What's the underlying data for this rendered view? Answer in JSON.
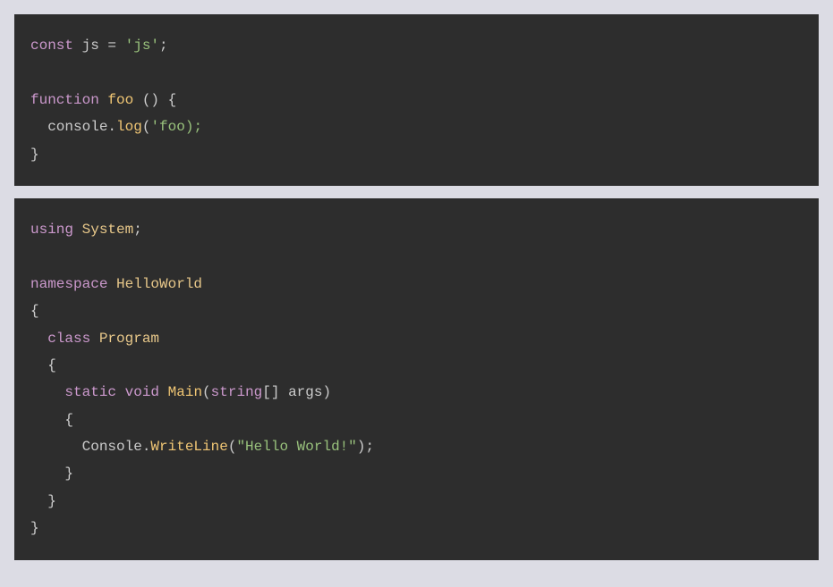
{
  "blocks": [
    {
      "lang": "javascript",
      "tokens": [
        [
          {
            "t": "const ",
            "c": "kw"
          },
          {
            "t": "js ",
            "c": "plain"
          },
          {
            "t": "= ",
            "c": "plain"
          },
          {
            "t": "'js'",
            "c": "str"
          },
          {
            "t": ";",
            "c": "plain"
          }
        ],
        [
          {
            "t": "",
            "c": "plain"
          }
        ],
        [
          {
            "t": "function ",
            "c": "kw"
          },
          {
            "t": "foo ",
            "c": "fn"
          },
          {
            "t": "() {",
            "c": "plain"
          }
        ],
        [
          {
            "t": "  console.",
            "c": "plain"
          },
          {
            "t": "log",
            "c": "fn"
          },
          {
            "t": "(",
            "c": "plain"
          },
          {
            "t": "'foo);",
            "c": "str"
          }
        ],
        [
          {
            "t": "}",
            "c": "plain"
          }
        ]
      ]
    },
    {
      "lang": "csharp",
      "tokens": [
        [
          {
            "t": "using ",
            "c": "kw"
          },
          {
            "t": "System",
            "c": "cls"
          },
          {
            "t": ";",
            "c": "plain"
          }
        ],
        [
          {
            "t": "",
            "c": "plain"
          }
        ],
        [
          {
            "t": "namespace ",
            "c": "kw"
          },
          {
            "t": "HelloWorld",
            "c": "cls"
          }
        ],
        [
          {
            "t": "{",
            "c": "plain"
          }
        ],
        [
          {
            "t": "  ",
            "c": "plain"
          },
          {
            "t": "class ",
            "c": "kw"
          },
          {
            "t": "Program",
            "c": "cls"
          }
        ],
        [
          {
            "t": "  {",
            "c": "plain"
          }
        ],
        [
          {
            "t": "    ",
            "c": "plain"
          },
          {
            "t": "static ",
            "c": "kw"
          },
          {
            "t": "void ",
            "c": "kw"
          },
          {
            "t": "Main",
            "c": "fn"
          },
          {
            "t": "(",
            "c": "plain"
          },
          {
            "t": "string",
            "c": "kw"
          },
          {
            "t": "[] args)",
            "c": "plain"
          }
        ],
        [
          {
            "t": "    {",
            "c": "plain"
          }
        ],
        [
          {
            "t": "      Console.",
            "c": "plain"
          },
          {
            "t": "WriteLine",
            "c": "fn"
          },
          {
            "t": "(",
            "c": "plain"
          },
          {
            "t": "\"Hello World!\"",
            "c": "str"
          },
          {
            "t": ");",
            "c": "plain"
          }
        ],
        [
          {
            "t": "    }",
            "c": "plain"
          }
        ],
        [
          {
            "t": "  }",
            "c": "plain"
          }
        ],
        [
          {
            "t": "}",
            "c": "plain"
          }
        ]
      ]
    }
  ]
}
